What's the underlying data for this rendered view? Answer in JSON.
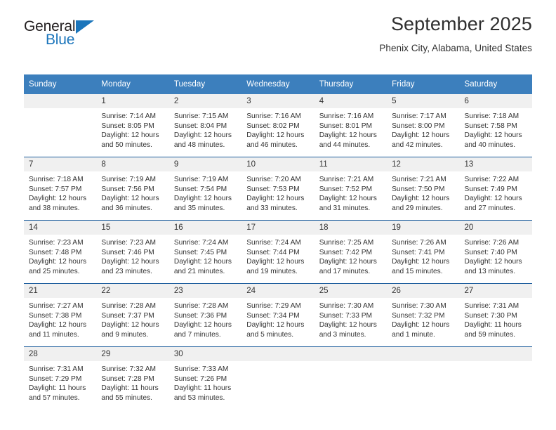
{
  "brand": {
    "name_part1": "General",
    "name_part2": "Blue",
    "accent_color": "#1b75bb"
  },
  "header": {
    "month_title": "September 2025",
    "location": "Phenix City, Alabama, United States"
  },
  "calendar": {
    "header_bg": "#3c7fbd",
    "daynum_bg": "#f0f0f0",
    "weekdays": [
      "Sunday",
      "Monday",
      "Tuesday",
      "Wednesday",
      "Thursday",
      "Friday",
      "Saturday"
    ],
    "weeks": [
      [
        {
          "day": "",
          "sunrise": "",
          "sunset": "",
          "daylight1": "",
          "daylight2": ""
        },
        {
          "day": "1",
          "sunrise": "Sunrise: 7:14 AM",
          "sunset": "Sunset: 8:05 PM",
          "daylight1": "Daylight: 12 hours",
          "daylight2": "and 50 minutes."
        },
        {
          "day": "2",
          "sunrise": "Sunrise: 7:15 AM",
          "sunset": "Sunset: 8:04 PM",
          "daylight1": "Daylight: 12 hours",
          "daylight2": "and 48 minutes."
        },
        {
          "day": "3",
          "sunrise": "Sunrise: 7:16 AM",
          "sunset": "Sunset: 8:02 PM",
          "daylight1": "Daylight: 12 hours",
          "daylight2": "and 46 minutes."
        },
        {
          "day": "4",
          "sunrise": "Sunrise: 7:16 AM",
          "sunset": "Sunset: 8:01 PM",
          "daylight1": "Daylight: 12 hours",
          "daylight2": "and 44 minutes."
        },
        {
          "day": "5",
          "sunrise": "Sunrise: 7:17 AM",
          "sunset": "Sunset: 8:00 PM",
          "daylight1": "Daylight: 12 hours",
          "daylight2": "and 42 minutes."
        },
        {
          "day": "6",
          "sunrise": "Sunrise: 7:18 AM",
          "sunset": "Sunset: 7:58 PM",
          "daylight1": "Daylight: 12 hours",
          "daylight2": "and 40 minutes."
        }
      ],
      [
        {
          "day": "7",
          "sunrise": "Sunrise: 7:18 AM",
          "sunset": "Sunset: 7:57 PM",
          "daylight1": "Daylight: 12 hours",
          "daylight2": "and 38 minutes."
        },
        {
          "day": "8",
          "sunrise": "Sunrise: 7:19 AM",
          "sunset": "Sunset: 7:56 PM",
          "daylight1": "Daylight: 12 hours",
          "daylight2": "and 36 minutes."
        },
        {
          "day": "9",
          "sunrise": "Sunrise: 7:19 AM",
          "sunset": "Sunset: 7:54 PM",
          "daylight1": "Daylight: 12 hours",
          "daylight2": "and 35 minutes."
        },
        {
          "day": "10",
          "sunrise": "Sunrise: 7:20 AM",
          "sunset": "Sunset: 7:53 PM",
          "daylight1": "Daylight: 12 hours",
          "daylight2": "and 33 minutes."
        },
        {
          "day": "11",
          "sunrise": "Sunrise: 7:21 AM",
          "sunset": "Sunset: 7:52 PM",
          "daylight1": "Daylight: 12 hours",
          "daylight2": "and 31 minutes."
        },
        {
          "day": "12",
          "sunrise": "Sunrise: 7:21 AM",
          "sunset": "Sunset: 7:50 PM",
          "daylight1": "Daylight: 12 hours",
          "daylight2": "and 29 minutes."
        },
        {
          "day": "13",
          "sunrise": "Sunrise: 7:22 AM",
          "sunset": "Sunset: 7:49 PM",
          "daylight1": "Daylight: 12 hours",
          "daylight2": "and 27 minutes."
        }
      ],
      [
        {
          "day": "14",
          "sunrise": "Sunrise: 7:23 AM",
          "sunset": "Sunset: 7:48 PM",
          "daylight1": "Daylight: 12 hours",
          "daylight2": "and 25 minutes."
        },
        {
          "day": "15",
          "sunrise": "Sunrise: 7:23 AM",
          "sunset": "Sunset: 7:46 PM",
          "daylight1": "Daylight: 12 hours",
          "daylight2": "and 23 minutes."
        },
        {
          "day": "16",
          "sunrise": "Sunrise: 7:24 AM",
          "sunset": "Sunset: 7:45 PM",
          "daylight1": "Daylight: 12 hours",
          "daylight2": "and 21 minutes."
        },
        {
          "day": "17",
          "sunrise": "Sunrise: 7:24 AM",
          "sunset": "Sunset: 7:44 PM",
          "daylight1": "Daylight: 12 hours",
          "daylight2": "and 19 minutes."
        },
        {
          "day": "18",
          "sunrise": "Sunrise: 7:25 AM",
          "sunset": "Sunset: 7:42 PM",
          "daylight1": "Daylight: 12 hours",
          "daylight2": "and 17 minutes."
        },
        {
          "day": "19",
          "sunrise": "Sunrise: 7:26 AM",
          "sunset": "Sunset: 7:41 PM",
          "daylight1": "Daylight: 12 hours",
          "daylight2": "and 15 minutes."
        },
        {
          "day": "20",
          "sunrise": "Sunrise: 7:26 AM",
          "sunset": "Sunset: 7:40 PM",
          "daylight1": "Daylight: 12 hours",
          "daylight2": "and 13 minutes."
        }
      ],
      [
        {
          "day": "21",
          "sunrise": "Sunrise: 7:27 AM",
          "sunset": "Sunset: 7:38 PM",
          "daylight1": "Daylight: 12 hours",
          "daylight2": "and 11 minutes."
        },
        {
          "day": "22",
          "sunrise": "Sunrise: 7:28 AM",
          "sunset": "Sunset: 7:37 PM",
          "daylight1": "Daylight: 12 hours",
          "daylight2": "and 9 minutes."
        },
        {
          "day": "23",
          "sunrise": "Sunrise: 7:28 AM",
          "sunset": "Sunset: 7:36 PM",
          "daylight1": "Daylight: 12 hours",
          "daylight2": "and 7 minutes."
        },
        {
          "day": "24",
          "sunrise": "Sunrise: 7:29 AM",
          "sunset": "Sunset: 7:34 PM",
          "daylight1": "Daylight: 12 hours",
          "daylight2": "and 5 minutes."
        },
        {
          "day": "25",
          "sunrise": "Sunrise: 7:30 AM",
          "sunset": "Sunset: 7:33 PM",
          "daylight1": "Daylight: 12 hours",
          "daylight2": "and 3 minutes."
        },
        {
          "day": "26",
          "sunrise": "Sunrise: 7:30 AM",
          "sunset": "Sunset: 7:32 PM",
          "daylight1": "Daylight: 12 hours",
          "daylight2": "and 1 minute."
        },
        {
          "day": "27",
          "sunrise": "Sunrise: 7:31 AM",
          "sunset": "Sunset: 7:30 PM",
          "daylight1": "Daylight: 11 hours",
          "daylight2": "and 59 minutes."
        }
      ],
      [
        {
          "day": "28",
          "sunrise": "Sunrise: 7:31 AM",
          "sunset": "Sunset: 7:29 PM",
          "daylight1": "Daylight: 11 hours",
          "daylight2": "and 57 minutes."
        },
        {
          "day": "29",
          "sunrise": "Sunrise: 7:32 AM",
          "sunset": "Sunset: 7:28 PM",
          "daylight1": "Daylight: 11 hours",
          "daylight2": "and 55 minutes."
        },
        {
          "day": "30",
          "sunrise": "Sunrise: 7:33 AM",
          "sunset": "Sunset: 7:26 PM",
          "daylight1": "Daylight: 11 hours",
          "daylight2": "and 53 minutes."
        },
        {
          "day": "",
          "sunrise": "",
          "sunset": "",
          "daylight1": "",
          "daylight2": ""
        },
        {
          "day": "",
          "sunrise": "",
          "sunset": "",
          "daylight1": "",
          "daylight2": ""
        },
        {
          "day": "",
          "sunrise": "",
          "sunset": "",
          "daylight1": "",
          "daylight2": ""
        },
        {
          "day": "",
          "sunrise": "",
          "sunset": "",
          "daylight1": "",
          "daylight2": ""
        }
      ]
    ]
  }
}
